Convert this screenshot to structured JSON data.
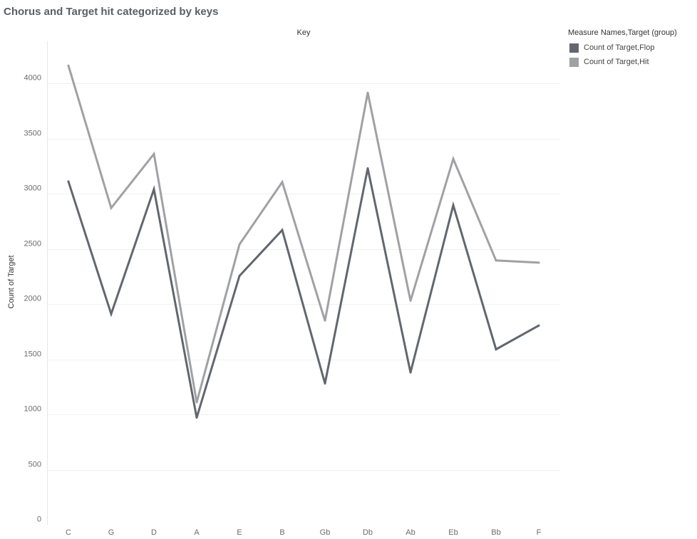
{
  "title": "Chorus and Target hit categorized by keys",
  "legend": {
    "title": "Measure Names,Target (group)"
  },
  "chart_data": {
    "type": "line",
    "title": "Chorus and Target hit categorized by keys",
    "column_header": "Key",
    "xlabel": "",
    "ylabel": "Count of Target",
    "categories": [
      "C",
      "G",
      "D",
      "A",
      "E",
      "B",
      "Gb",
      "Db",
      "Ab",
      "Eb",
      "Bb",
      "F"
    ],
    "ylim": [
      0,
      4300
    ],
    "yticks": [
      0,
      500,
      1000,
      1500,
      2000,
      2500,
      3000,
      3500,
      4000
    ],
    "grid": true,
    "legend_position": "top-right",
    "series": [
      {
        "name": "Count of Target,Flop",
        "color": "#62676f",
        "values": [
          3110,
          1910,
          3040,
          970,
          2255,
          2670,
          1280,
          3230,
          1380,
          2895,
          1590,
          1805
        ]
      },
      {
        "name": "Count of Target,Hit",
        "color": "#a0a1a4",
        "values": [
          4160,
          2870,
          3360,
          1110,
          2540,
          3105,
          1850,
          3915,
          2030,
          3315,
          2395,
          2375
        ]
      }
    ]
  }
}
